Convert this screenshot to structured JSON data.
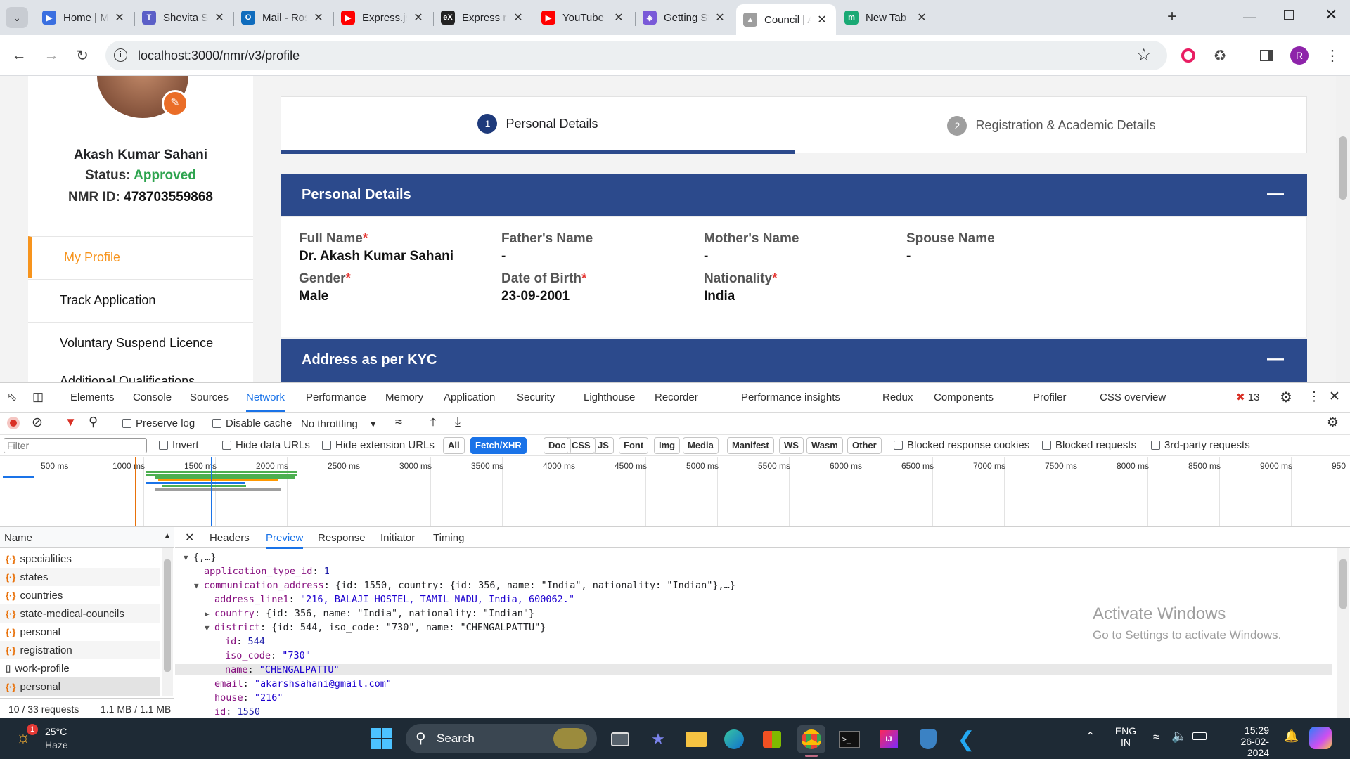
{
  "browser": {
    "tabs": [
      {
        "label": "Home | Micro",
        "icon": "edge-icon"
      },
      {
        "label": "Shevita Soi | ",
        "icon": "teams-icon"
      },
      {
        "label": "Mail - Roshan",
        "icon": "outlook-icon"
      },
      {
        "label": "Express.js",
        "icon": "youtube-icon"
      },
      {
        "label": "Express routi",
        "icon": "ex-icon"
      },
      {
        "label": "YouTube",
        "icon": "youtube-icon"
      },
      {
        "label": "Getting Starte",
        "icon": "graphql-icon"
      },
      {
        "label": "Council | ABD",
        "icon": "council-icon",
        "active": true
      },
      {
        "label": "New Tab",
        "icon": "m-icon"
      }
    ],
    "url": "localhost:3000/nmr/v3/profile",
    "profile_initial": "R"
  },
  "sidebar": {
    "name": "Akash Kumar Sahani",
    "status_label": "Status:",
    "status_value": "Approved",
    "nmr_label": "NMR ID:",
    "nmr_value": "478703559868",
    "items": [
      {
        "label": "My Profile",
        "active": true
      },
      {
        "label": "Track Application"
      },
      {
        "label": "Voluntary Suspend Licence"
      },
      {
        "label": "Additional Qualifications"
      }
    ]
  },
  "steps": [
    {
      "num": "1",
      "label": "Personal Details",
      "active": true
    },
    {
      "num": "2",
      "label": "Registration & Academic Details"
    }
  ],
  "personal": {
    "title": "Personal Details",
    "collapse_glyph": "—",
    "fields": [
      {
        "label": "Full Name",
        "required": "*",
        "value": "Dr. Akash Kumar Sahani"
      },
      {
        "label": "Father's Name",
        "required": "",
        "value": "-"
      },
      {
        "label": "Mother's Name",
        "required": "",
        "value": "-"
      },
      {
        "label": "Spouse Name",
        "required": "",
        "value": "-"
      },
      {
        "label": "Gender",
        "required": "*",
        "value": "Male"
      },
      {
        "label": "Date of Birth",
        "required": "*",
        "value": "23-09-2001"
      },
      {
        "label": "Nationality",
        "required": "*",
        "value": "India"
      }
    ]
  },
  "address": {
    "title": "Address as per KYC",
    "collapse_glyph": "—"
  },
  "devtools": {
    "tabs": [
      "Elements",
      "Console",
      "Sources",
      "Network",
      "Performance",
      "Memory",
      "Application",
      "Security",
      "Lighthouse",
      "Recorder",
      "Performance insights",
      "Redux",
      "Components",
      "Profiler",
      "CSS overview"
    ],
    "active_tab": "Network",
    "error_count": "13",
    "preserve_log": "Preserve log",
    "disable_cache": "Disable cache",
    "throttling": "No throttling",
    "filter_placeholder": "Filter",
    "invert": "Invert",
    "hide_data_urls": "Hide data URLs",
    "hide_ext_urls": "Hide extension URLs",
    "type_filters": [
      "All",
      "Fetch/XHR",
      "Doc",
      "CSS",
      "JS",
      "Font",
      "Img",
      "Media",
      "Manifest",
      "WS",
      "Wasm",
      "Other"
    ],
    "active_type": "Fetch/XHR",
    "blocked_cookies": "Blocked response cookies",
    "blocked_requests": "Blocked requests",
    "third_party": "3rd-party requests",
    "timeline_ticks": [
      "500 ms",
      "1000 ms",
      "1500 ms",
      "2000 ms",
      "2500 ms",
      "3000 ms",
      "3500 ms",
      "4000 ms",
      "4500 ms",
      "5000 ms",
      "5500 ms",
      "6000 ms",
      "6500 ms",
      "7000 ms",
      "7500 ms",
      "8000 ms",
      "8500 ms",
      "9000 ms",
      "950"
    ],
    "name_header": "Name",
    "requests": [
      {
        "name": "specialities",
        "kind": "xhr"
      },
      {
        "name": "states",
        "kind": "xhr"
      },
      {
        "name": "countries",
        "kind": "xhr"
      },
      {
        "name": "state-medical-councils",
        "kind": "xhr"
      },
      {
        "name": "personal",
        "kind": "xhr"
      },
      {
        "name": "registration",
        "kind": "xhr"
      },
      {
        "name": "work-profile",
        "kind": "doc"
      },
      {
        "name": "personal",
        "kind": "xhr",
        "selected": true
      }
    ],
    "summary_requests": "10 / 33 requests",
    "summary_size": "1.1 MB / 1.1 MB",
    "detail_tabs": [
      "Headers",
      "Preview",
      "Response",
      "Initiator",
      "Timing"
    ],
    "active_detail": "Preview",
    "json_lines": [
      {
        "indent": 0,
        "arrow": "▼",
        "key": "",
        "sep": "",
        "value": "{,…}",
        "vtype": "p"
      },
      {
        "indent": 1,
        "arrow": "",
        "key": "application_type_id",
        "sep": ": ",
        "value": "1",
        "vtype": "v"
      },
      {
        "indent": 1,
        "arrow": "▼",
        "key": "communication_address",
        "sep": ": ",
        "value": "{id: 1550, country: {id: 356, name: \"India\", nationality: \"Indian\"},…}",
        "vtype": "p"
      },
      {
        "indent": 2,
        "arrow": "",
        "key": "address_line1",
        "sep": ": ",
        "value": "\"216, BALAJI HOSTEL, TAMIL NADU, India, 600062.\"",
        "vtype": "s"
      },
      {
        "indent": 2,
        "arrow": "▶",
        "key": "country",
        "sep": ": ",
        "value": "{id: 356, name: \"India\", nationality: \"Indian\"}",
        "vtype": "p"
      },
      {
        "indent": 2,
        "arrow": "▼",
        "key": "district",
        "sep": ": ",
        "value": "{id: 544, iso_code: \"730\", name: \"CHENGALPATTU\"}",
        "vtype": "p"
      },
      {
        "indent": 3,
        "arrow": "",
        "key": "id",
        "sep": ": ",
        "value": "544",
        "vtype": "v"
      },
      {
        "indent": 3,
        "arrow": "",
        "key": "iso_code",
        "sep": ": ",
        "value": "\"730\"",
        "vtype": "s"
      },
      {
        "indent": 3,
        "arrow": "",
        "key": "name",
        "sep": ": ",
        "value": "\"CHENGALPATTU\"",
        "vtype": "s",
        "hl": true
      },
      {
        "indent": 2,
        "arrow": "",
        "key": "email",
        "sep": ": ",
        "value": "\"akarshsahani@gmail.com\"",
        "vtype": "s"
      },
      {
        "indent": 2,
        "arrow": "",
        "key": "house",
        "sep": ": ",
        "value": "\"216\"",
        "vtype": "s"
      },
      {
        "indent": 2,
        "arrow": "",
        "key": "id",
        "sep": ": ",
        "value": "1550",
        "vtype": "v"
      }
    ],
    "watermark_title": "Activate Windows",
    "watermark_sub": "Go to Settings to activate Windows."
  },
  "taskbar": {
    "temp": "25°C",
    "weather": "Haze",
    "weather_badge": "1",
    "search": "Search",
    "lang1": "ENG",
    "lang2": "IN",
    "time": "15:29",
    "date": "26-02-2024"
  },
  "colors": {
    "primary": "#2c4a8c",
    "accent_orange": "#f7941d",
    "approved_green": "#2ea44f",
    "devtools_blue": "#1a73e8"
  }
}
